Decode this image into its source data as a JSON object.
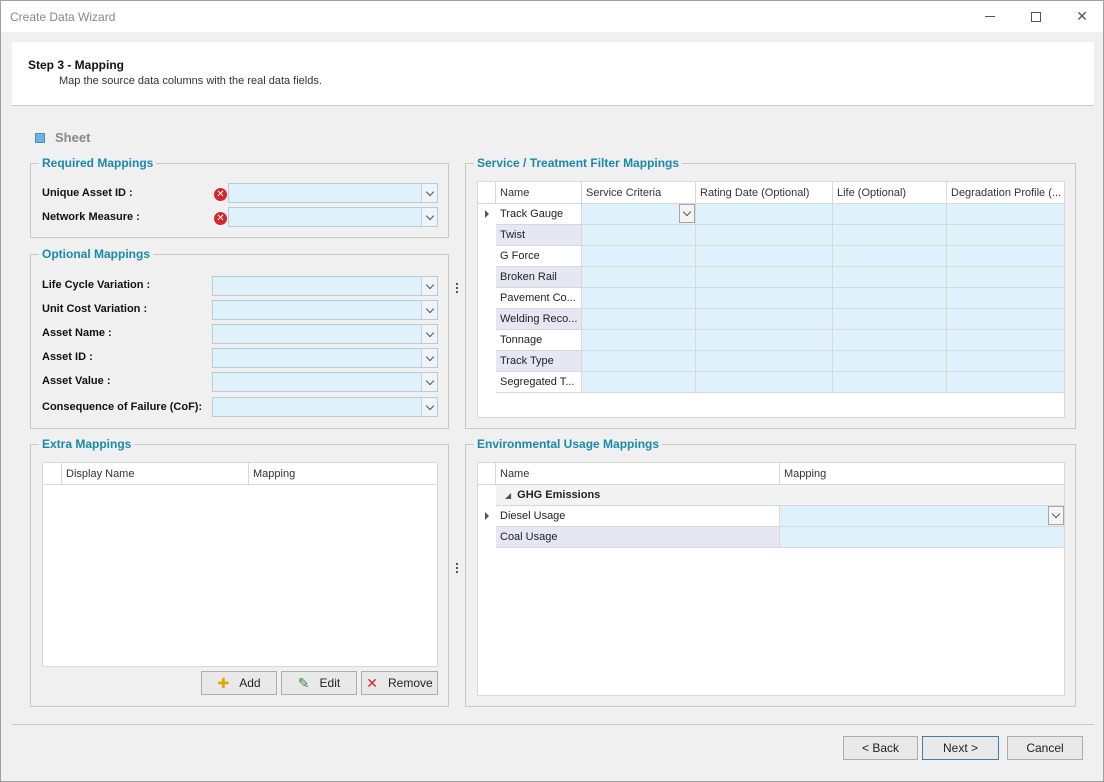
{
  "window": {
    "title": "Create Data Wizard"
  },
  "header": {
    "step": "Step 3 - Mapping",
    "description": "Map the source data columns with the real data fields."
  },
  "sheet": {
    "label": "Sheet"
  },
  "required": {
    "title": "Required Mappings",
    "fields": [
      {
        "label": "Unique Asset ID :",
        "value": ""
      },
      {
        "label": "Network Measure :",
        "value": ""
      }
    ]
  },
  "optional": {
    "title": "Optional Mappings",
    "fields": [
      {
        "label": "Life Cycle Variation :",
        "value": ""
      },
      {
        "label": "Unit Cost Variation :",
        "value": ""
      },
      {
        "label": "Asset Name :",
        "value": ""
      },
      {
        "label": "Asset ID :",
        "value": ""
      },
      {
        "label": "Asset Value :",
        "value": ""
      },
      {
        "label": "Consequence of Failure (CoF):",
        "value": ""
      }
    ]
  },
  "extra": {
    "title": "Extra Mappings",
    "columns": [
      "Display Name",
      "Mapping"
    ],
    "buttons": {
      "add": "Add",
      "edit": "Edit",
      "remove": "Remove"
    }
  },
  "service": {
    "title": "Service / Treatment Filter Mappings",
    "columns": [
      "Name",
      "Service Criteria",
      "Rating Date (Optional)",
      "Life (Optional)",
      "Degradation Profile (..."
    ],
    "rows": [
      "Track Gauge",
      "Twist",
      "G Force",
      "Broken Rail",
      "Pavement Co...",
      "Welding Reco...",
      "Tonnage",
      "Track Type",
      "Segregated T..."
    ]
  },
  "environmental": {
    "title": "Environmental Usage Mappings",
    "columns": [
      "Name",
      "Mapping"
    ],
    "group": "GHG Emissions",
    "rows": [
      "Diesel Usage",
      "Coal Usage"
    ]
  },
  "footer": {
    "back": "< Back",
    "next": "Next >",
    "cancel": "Cancel"
  }
}
